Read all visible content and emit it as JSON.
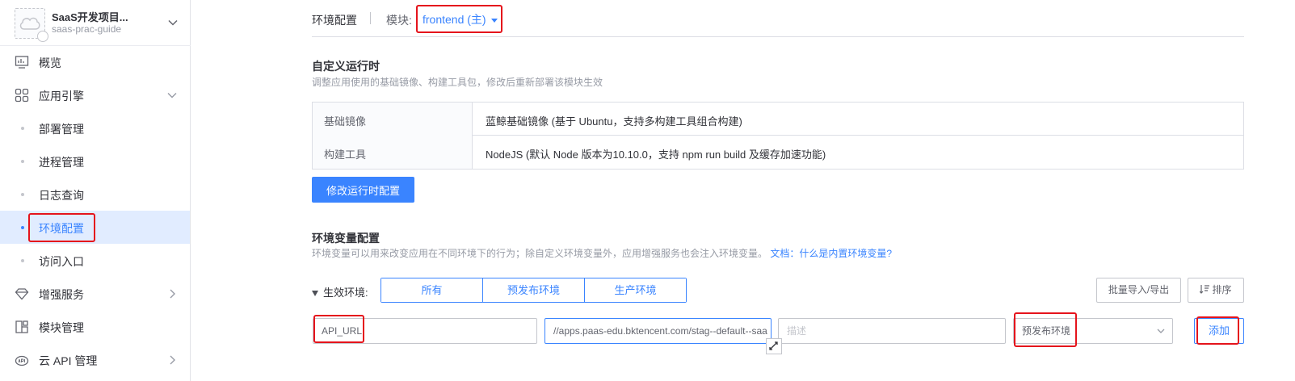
{
  "app": {
    "name": "SaaS开发项目...",
    "code": "saas-prac-guide"
  },
  "sidebar": {
    "items": [
      {
        "label": "概览",
        "icon": "monitor-icon"
      },
      {
        "label": "应用引擎",
        "icon": "grid-icon"
      },
      {
        "label": "部署管理"
      },
      {
        "label": "进程管理"
      },
      {
        "label": "日志查询"
      },
      {
        "label": "环境配置",
        "active": true
      },
      {
        "label": "访问入口"
      },
      {
        "label": "增强服务",
        "icon": "diamond-icon"
      },
      {
        "label": "模块管理",
        "icon": "module-icon"
      },
      {
        "label": "云 API 管理",
        "icon": "api-icon"
      }
    ]
  },
  "header": {
    "title": "环境配置",
    "module_label": "模块:",
    "module_value": "frontend (主)"
  },
  "runtime": {
    "title": "自定义运行时",
    "desc": "调整应用使用的基础镜像、构建工具包，修改后重新部署该模块生效",
    "rows": [
      {
        "key": "基础镜像",
        "value": "蓝鲸基础镜像 (基于 Ubuntu，支持多构建工具组合构建)"
      },
      {
        "key": "构建工具",
        "value": "NodeJS (默认 Node 版本为10.10.0，支持 npm run build 及缓存加速功能)"
      }
    ],
    "button": "修改运行时配置"
  },
  "env": {
    "title": "环境变量配置",
    "desc": "环境变量可以用来改变应用在不同环境下的行为；除自定义环境变量外，应用增强服务也会注入环境变量。",
    "doc_link": "文档：什么是内置环境变量?",
    "filter_label": "生效环境:",
    "segments": [
      "所有",
      "预发布环境",
      "生产环境"
    ],
    "batch_button": "批量导入/导出",
    "sort_button": "排序",
    "form": {
      "key_value": "API_URL",
      "value_value": "//apps.paas-edu.bktencent.com/stag--default--saa",
      "desc_placeholder": "描述",
      "env_value": "预发布环境",
      "add_button": "添加"
    }
  },
  "colors": {
    "primary": "#3a84ff",
    "annotation": "#e5141c",
    "active_bg": "#e1ecff"
  }
}
